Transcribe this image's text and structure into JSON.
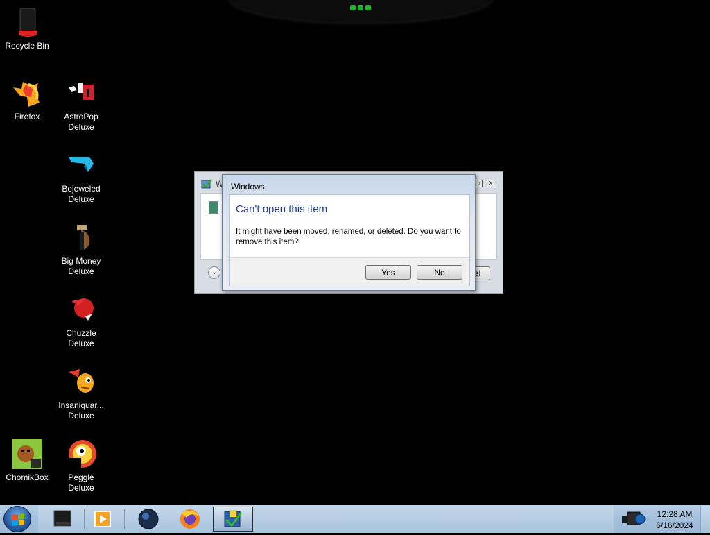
{
  "desktop": {
    "icons": [
      {
        "label": "Recycle Bin",
        "icon": "recycle-bin-icon"
      },
      {
        "label": "Firefox",
        "icon": "firefox-icon"
      },
      {
        "label": "AstroPop\nDeluxe",
        "icon": "astropop-icon"
      },
      {
        "label": "Bejeweled\nDeluxe",
        "icon": "bejeweled-icon"
      },
      {
        "label": "Big Money\nDeluxe",
        "icon": "big-money-icon"
      },
      {
        "label": "Chuzzle\nDeluxe",
        "icon": "chuzzle-icon"
      },
      {
        "label": "Insaniquar...\nDeluxe",
        "icon": "insaniquarium-icon"
      },
      {
        "label": "ChomikBox",
        "icon": "chomikbox-icon"
      },
      {
        "label": "Peggle Deluxe",
        "icon": "peggle-icon"
      }
    ]
  },
  "background_window": {
    "title_partial": "W",
    "button_partial": "el"
  },
  "dialog": {
    "caption": "Windows",
    "heading": "Can't open this item",
    "message": "It might have been moved, renamed, or deleted. Do you want to remove this item?",
    "yes_label": "Yes",
    "no_label": "No"
  },
  "taskbar": {
    "buttons": [
      "explorer-icon",
      "media-player-icon",
      "globe-icon",
      "firefox-icon",
      "game-window-icon"
    ],
    "active_index": 4
  },
  "clock": {
    "time": "12:28 AM",
    "date": "6/16/2024"
  },
  "colors": {
    "heading": "#1e3e96",
    "taskbar": "#a3bfdb",
    "desktop": "#000000"
  }
}
